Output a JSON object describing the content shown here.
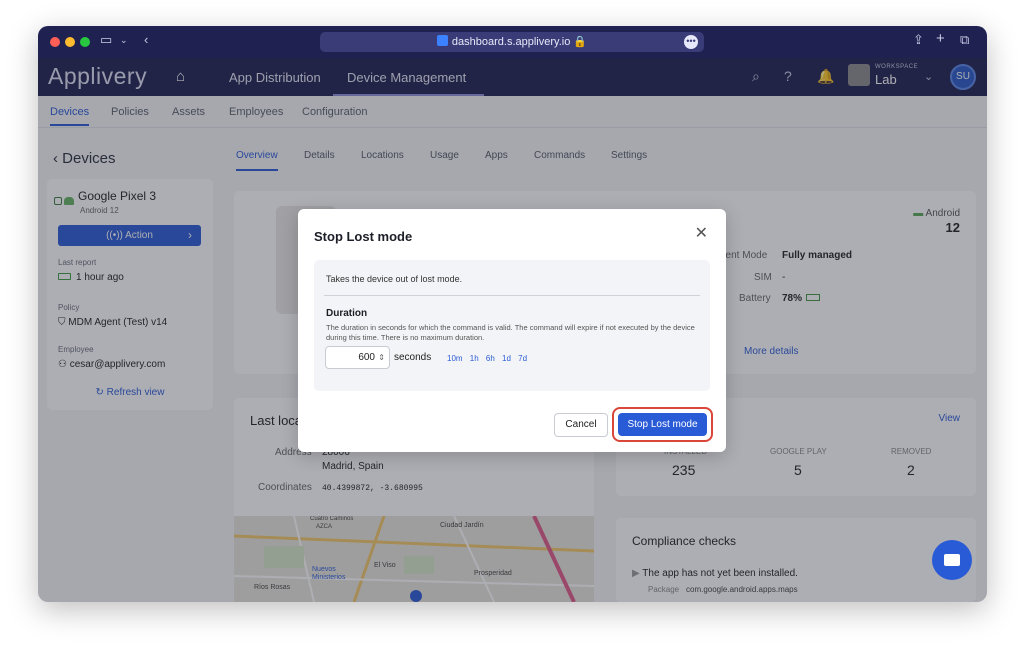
{
  "browser": {
    "url": "dashboard.s.applivery.io"
  },
  "app": {
    "brand": "Applivery",
    "nav_tabs": [
      "App Distribution",
      "Device Management"
    ],
    "workspace_label": "WORKSPACE",
    "workspace_name": "Lab",
    "user_initials": "SU"
  },
  "subnav": [
    "Devices",
    "Policies",
    "Assets",
    "Employees",
    "Configuration"
  ],
  "sidebar": {
    "back_label": "Devices",
    "device_name": "Google Pixel 3",
    "device_os": "Android 12",
    "action_label": "Action",
    "last_report_label": "Last report",
    "last_report_value": "1 hour ago",
    "policy_label": "Policy",
    "policy_value": "MDM Agent (Test)  v14",
    "employee_label": "Employee",
    "employee_value": "cesar@applivery.com",
    "refresh_label": "Refresh view"
  },
  "device_tabs": [
    "Overview",
    "Details",
    "Locations",
    "Usage",
    "Apps",
    "Commands",
    "Settings"
  ],
  "overview": {
    "os_name": "Android",
    "os_version": "12",
    "mgmt_label": "nent Mode",
    "mgmt_value": "Fully managed",
    "sim_label": "SIM",
    "sim_value": "-",
    "battery_label": "Battery",
    "battery_value": "78%",
    "more_details": "More details"
  },
  "location": {
    "title": "Last loca",
    "address_label": "Address",
    "address_line1": "28006",
    "address_line2": "Madrid, Spain",
    "coords_label": "Coordinates",
    "coords_value": "40.4399872, -3.680995",
    "map_labels": [
      "Ciudad Jardín",
      "Prosperidad",
      "El Viso",
      "Nuevos Ministerios",
      "Ríos Rosas",
      "Cuatro Caminos",
      "AZCA"
    ]
  },
  "apps_card": {
    "view_label": "View",
    "installed_label": "INSTALLED",
    "installed_value": "235",
    "gplay_label": "GOOGLE PLAY",
    "gplay_value": "5",
    "removed_label": "REMOVED",
    "removed_value": "2"
  },
  "compliance": {
    "title": "Compliance checks",
    "item": "The app has not yet been installed.",
    "package_label": "Package",
    "package_value": "com.google.android.apps.maps"
  },
  "modal": {
    "title": "Stop Lost mode",
    "description": "Takes the device out of lost mode.",
    "duration_label": "Duration",
    "duration_help": "The duration in seconds for which the command is valid. The command will expire if not executed by the device during this time. There is no maximum duration.",
    "duration_value": "600",
    "duration_unit": "seconds",
    "presets": "10m 1h 6h 1d 7d",
    "cancel_label": "Cancel",
    "confirm_label": "Stop Lost mode"
  },
  "colors": {
    "primary": "#2a5bd7",
    "header": "#1f2151",
    "highlight": "#d9463a"
  }
}
